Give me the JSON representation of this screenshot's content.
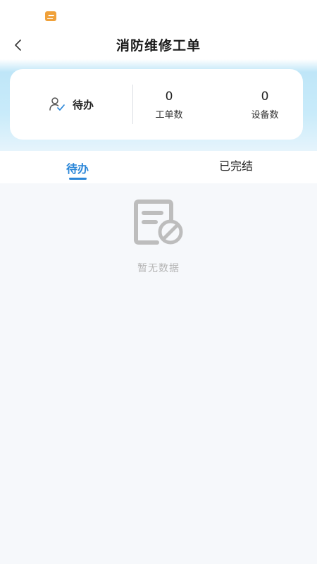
{
  "nav": {
    "title": "消防维修工单"
  },
  "summary": {
    "pending_label": "待办",
    "order_count": "0",
    "order_label": "工单数",
    "device_count": "0",
    "device_label": "设备数"
  },
  "tabs": [
    {
      "label": "待办",
      "active": true
    },
    {
      "label": "已完结",
      "active": false
    }
  ],
  "empty": {
    "text": "暂无数据"
  },
  "colors": {
    "accent": "#2a86d8",
    "status_icon": "#f0a13a",
    "header_gradient": "#c9ebfa",
    "empty_icon": "#bdbdbd"
  },
  "icons": {
    "status": "app-notification-icon",
    "back": "chevron-left-icon",
    "pending": "user-check-icon",
    "empty": "document-ban-icon"
  }
}
